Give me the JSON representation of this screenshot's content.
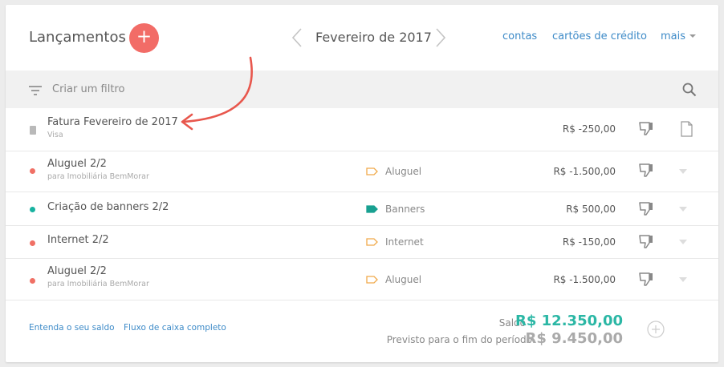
{
  "header": {
    "title": "Lançamentos",
    "add_symbol": "+",
    "month": "Fevereiro de 2017",
    "links": {
      "contas": "contas",
      "cartoes": "cartões de crédito",
      "mais": "mais"
    }
  },
  "filter": {
    "label": "Criar um filtro"
  },
  "rows": [
    {
      "title": "Fatura Fevereiro de 2017",
      "subtitle": "Visa",
      "indicator": "document-icon",
      "tag": "",
      "amount": "R$ -250,00",
      "action": "file-icon"
    },
    {
      "title": "Aluguel 2/2",
      "subtitle": "para Imobiliária BemMorar",
      "indicator": "dot",
      "color": "#f07065",
      "tag": "Aluguel",
      "tag_color": "#f0a94a",
      "tag_filled": false,
      "amount": "R$ -1.500,00",
      "action": "chevron-down-icon"
    },
    {
      "title": "Criação de banners 2/2",
      "subtitle": "",
      "indicator": "dot",
      "color": "#18b2a0",
      "tag": "Banners",
      "tag_color": "#18a091",
      "tag_filled": true,
      "amount": "R$ 500,00",
      "action": "chevron-down-icon"
    },
    {
      "title": "Internet 2/2",
      "subtitle": "",
      "indicator": "dot",
      "color": "#f07065",
      "tag": "Internet",
      "tag_color": "#f0a94a",
      "tag_filled": false,
      "amount": "R$ -150,00",
      "action": "chevron-down-icon"
    },
    {
      "title": "Aluguel 2/2",
      "subtitle": "para Imobiliária BemMorar",
      "indicator": "dot",
      "color": "#f07065",
      "tag": "Aluguel",
      "tag_color": "#f0a94a",
      "tag_filled": false,
      "amount": "R$ -1.500,00",
      "action": "chevron-down-icon"
    }
  ],
  "footer": {
    "link1": "Entenda o seu saldo",
    "link2": "Fluxo de caixa completo",
    "saldo_label": "Saldo",
    "saldo_value": "R$ 12.350,00",
    "previsto_label": "Previsto para o fim do período",
    "previsto_value": "R$ 9.450,00"
  },
  "colors": {
    "accent": "#f26c67",
    "link": "#3e8bc8",
    "positive": "#2bb7a5",
    "annotation_arrow": "#e8574d"
  }
}
